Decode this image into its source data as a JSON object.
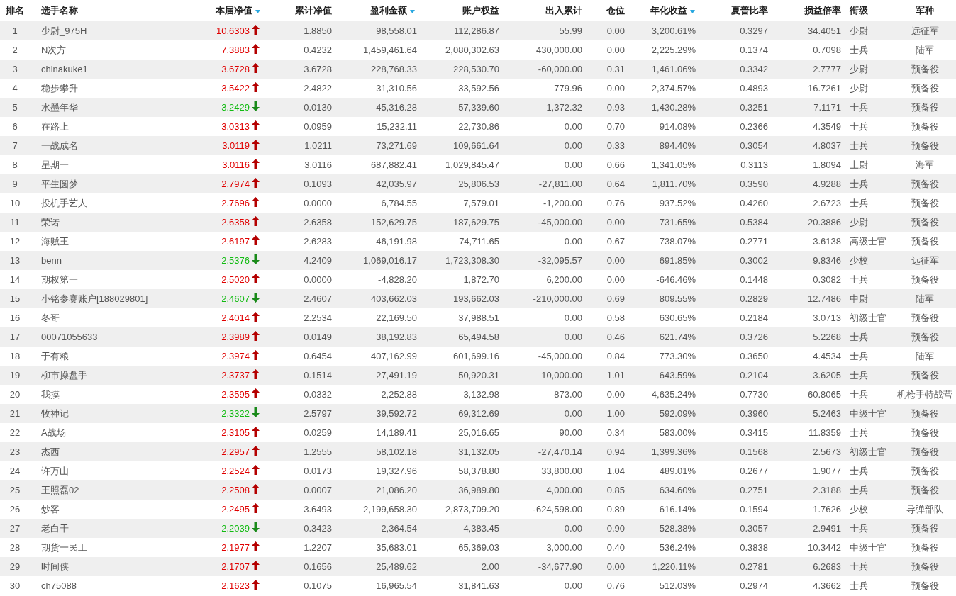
{
  "columns": [
    {
      "label": "排名",
      "sorted": false
    },
    {
      "label": "选手名称",
      "sorted": false
    },
    {
      "label": "本届净值",
      "sorted": true
    },
    {
      "label": "累计净值",
      "sorted": false
    },
    {
      "label": "盈利金额",
      "sorted": true
    },
    {
      "label": "账户权益",
      "sorted": false
    },
    {
      "label": "出入累计",
      "sorted": false
    },
    {
      "label": "仓位",
      "sorted": false
    },
    {
      "label": "年化收益",
      "sorted": true
    },
    {
      "label": "夏普比率",
      "sorted": false
    },
    {
      "label": "损益倍率",
      "sorted": false
    },
    {
      "label": "衔级",
      "sorted": false
    },
    {
      "label": "军种",
      "sorted": false
    }
  ],
  "rows": [
    {
      "rising": true,
      "cells": [
        "1",
        "少尉_975H",
        "10.6303",
        "1.8850",
        "98,558.01",
        "112,286.87",
        "55.99",
        "0.00",
        "3,200.61%",
        "0.3297",
        "34.4051",
        "少尉",
        "远征军"
      ]
    },
    {
      "rising": true,
      "cells": [
        "2",
        "N次方",
        "7.3883",
        "0.4232",
        "1,459,461.64",
        "2,080,302.63",
        "430,000.00",
        "0.00",
        "2,225.29%",
        "0.1374",
        "0.7098",
        "士兵",
        "陆军"
      ]
    },
    {
      "rising": true,
      "cells": [
        "3",
        "chinakuke1",
        "3.6728",
        "3.6728",
        "228,768.33",
        "228,530.70",
        "-60,000.00",
        "0.31",
        "1,461.06%",
        "0.3342",
        "2.7777",
        "少尉",
        "预备役"
      ]
    },
    {
      "rising": true,
      "cells": [
        "4",
        "稳步攀升",
        "3.5422",
        "2.4822",
        "31,310.56",
        "33,592.56",
        "779.96",
        "0.00",
        "2,374.57%",
        "0.4893",
        "16.7261",
        "少尉",
        "预备役"
      ]
    },
    {
      "rising": false,
      "cells": [
        "5",
        "水墨年华",
        "3.2429",
        "0.0130",
        "45,316.28",
        "57,339.60",
        "1,372.32",
        "0.93",
        "1,430.28%",
        "0.3251",
        "7.1171",
        "士兵",
        "预备役"
      ]
    },
    {
      "rising": true,
      "cells": [
        "6",
        "在路上",
        "3.0313",
        "0.0959",
        "15,232.11",
        "22,730.86",
        "0.00",
        "0.70",
        "914.08%",
        "0.2366",
        "4.3549",
        "士兵",
        "预备役"
      ]
    },
    {
      "rising": true,
      "cells": [
        "7",
        "一战成名",
        "3.0119",
        "1.0211",
        "73,271.69",
        "109,661.64",
        "0.00",
        "0.33",
        "894.40%",
        "0.3054",
        "4.8037",
        "士兵",
        "预备役"
      ]
    },
    {
      "rising": true,
      "cells": [
        "8",
        "星期一",
        "3.0116",
        "3.0116",
        "687,882.41",
        "1,029,845.47",
        "0.00",
        "0.66",
        "1,341.05%",
        "0.3113",
        "1.8094",
        "上尉",
        "海军"
      ]
    },
    {
      "rising": true,
      "cells": [
        "9",
        "平生圆梦",
        "2.7974",
        "0.1093",
        "42,035.97",
        "25,806.53",
        "-27,811.00",
        "0.64",
        "1,811.70%",
        "0.3590",
        "4.9288",
        "士兵",
        "预备役"
      ]
    },
    {
      "rising": true,
      "cells": [
        "10",
        "投机手艺人",
        "2.7696",
        "0.0000",
        "6,784.55",
        "7,579.01",
        "-1,200.00",
        "0.76",
        "937.52%",
        "0.4260",
        "2.6723",
        "士兵",
        "预备役"
      ]
    },
    {
      "rising": true,
      "cells": [
        "11",
        "荣诺",
        "2.6358",
        "2.6358",
        "152,629.75",
        "187,629.75",
        "-45,000.00",
        "0.00",
        "731.65%",
        "0.5384",
        "20.3886",
        "少尉",
        "预备役"
      ]
    },
    {
      "rising": true,
      "cells": [
        "12",
        "海贼王",
        "2.6197",
        "2.6283",
        "46,191.98",
        "74,711.65",
        "0.00",
        "0.67",
        "738.07%",
        "0.2771",
        "3.6138",
        "高级士官",
        "预备役"
      ]
    },
    {
      "rising": false,
      "cells": [
        "13",
        "benn",
        "2.5376",
        "4.2409",
        "1,069,016.17",
        "1,723,308.30",
        "-32,095.57",
        "0.00",
        "691.85%",
        "0.3002",
        "9.8346",
        "少校",
        "远征军"
      ]
    },
    {
      "rising": true,
      "cells": [
        "14",
        "期权第一",
        "2.5020",
        "0.0000",
        "-4,828.20",
        "1,872.70",
        "6,200.00",
        "0.00",
        "-646.46%",
        "0.1448",
        "0.3082",
        "士兵",
        "预备役"
      ]
    },
    {
      "rising": false,
      "cells": [
        "15",
        "小铭参赛账户[188029801]",
        "2.4607",
        "2.4607",
        "403,662.03",
        "193,662.03",
        "-210,000.00",
        "0.69",
        "809.55%",
        "0.2829",
        "12.7486",
        "中尉",
        "陆军"
      ]
    },
    {
      "rising": true,
      "cells": [
        "16",
        "冬哥",
        "2.4014",
        "2.2534",
        "22,169.50",
        "37,988.51",
        "0.00",
        "0.58",
        "630.65%",
        "0.2184",
        "3.0713",
        "初级士官",
        "预备役"
      ]
    },
    {
      "rising": true,
      "cells": [
        "17",
        "00071055633",
        "2.3989",
        "0.0149",
        "38,192.83",
        "65,494.58",
        "0.00",
        "0.46",
        "621.74%",
        "0.3726",
        "5.2268",
        "士兵",
        "预备役"
      ]
    },
    {
      "rising": true,
      "cells": [
        "18",
        "于有粮",
        "2.3974",
        "0.6454",
        "407,162.99",
        "601,699.16",
        "-45,000.00",
        "0.84",
        "773.30%",
        "0.3650",
        "4.4534",
        "士兵",
        "陆军"
      ]
    },
    {
      "rising": true,
      "cells": [
        "19",
        "柳市操盘手",
        "2.3737",
        "0.1514",
        "27,491.19",
        "50,920.31",
        "10,000.00",
        "1.01",
        "643.59%",
        "0.2104",
        "3.6205",
        "士兵",
        "预备役"
      ]
    },
    {
      "rising": true,
      "cells": [
        "20",
        "我摸",
        "2.3595",
        "0.0332",
        "2,252.88",
        "3,132.98",
        "873.00",
        "0.00",
        "4,635.24%",
        "0.7730",
        "60.8065",
        "士兵",
        "机枪手特战营"
      ]
    },
    {
      "rising": false,
      "cells": [
        "21",
        "牧神记",
        "2.3322",
        "2.5797",
        "39,592.72",
        "69,312.69",
        "0.00",
        "1.00",
        "592.09%",
        "0.3960",
        "5.2463",
        "中级士官",
        "预备役"
      ]
    },
    {
      "rising": true,
      "cells": [
        "22",
        "A战场",
        "2.3105",
        "0.0259",
        "14,189.41",
        "25,016.65",
        "90.00",
        "0.34",
        "583.00%",
        "0.3415",
        "11.8359",
        "士兵",
        "预备役"
      ]
    },
    {
      "rising": true,
      "cells": [
        "23",
        "杰西",
        "2.2957",
        "1.2555",
        "58,102.18",
        "31,132.05",
        "-27,470.14",
        "0.94",
        "1,399.36%",
        "0.1568",
        "2.5673",
        "初级士官",
        "预备役"
      ]
    },
    {
      "rising": true,
      "cells": [
        "24",
        "许万山",
        "2.2524",
        "0.0173",
        "19,327.96",
        "58,378.80",
        "33,800.00",
        "1.04",
        "489.01%",
        "0.2677",
        "1.9077",
        "士兵",
        "预备役"
      ]
    },
    {
      "rising": true,
      "cells": [
        "25",
        "王照磊02",
        "2.2508",
        "0.0007",
        "21,086.20",
        "36,989.80",
        "4,000.00",
        "0.85",
        "634.60%",
        "0.2751",
        "2.3188",
        "士兵",
        "预备役"
      ]
    },
    {
      "rising": true,
      "cells": [
        "26",
        "炒客",
        "2.2495",
        "3.6493",
        "2,199,658.30",
        "2,873,709.20",
        "-624,598.00",
        "0.89",
        "616.14%",
        "0.1594",
        "1.7626",
        "少校",
        "导弹部队"
      ]
    },
    {
      "rising": false,
      "cells": [
        "27",
        "老白干",
        "2.2039",
        "0.3423",
        "2,364.54",
        "4,383.45",
        "0.00",
        "0.90",
        "528.38%",
        "0.3057",
        "2.9491",
        "士兵",
        "预备役"
      ]
    },
    {
      "rising": true,
      "cells": [
        "28",
        "期货一民工",
        "2.1977",
        "1.2207",
        "35,683.01",
        "65,369.03",
        "3,000.00",
        "0.40",
        "536.24%",
        "0.3838",
        "10.3442",
        "中级士官",
        "预备役"
      ]
    },
    {
      "rising": true,
      "cells": [
        "29",
        "时间侠",
        "2.1707",
        "0.1656",
        "25,489.62",
        "2.00",
        "-34,677.90",
        "0.00",
        "1,220.11%",
        "0.2781",
        "6.2683",
        "士兵",
        "预备役"
      ]
    },
    {
      "rising": true,
      "cells": [
        "30",
        "ch75088",
        "2.1623",
        "0.1075",
        "16,965.54",
        "31,841.63",
        "0.00",
        "0.76",
        "512.03%",
        "0.2974",
        "4.3662",
        "士兵",
        "预备役"
      ]
    }
  ]
}
